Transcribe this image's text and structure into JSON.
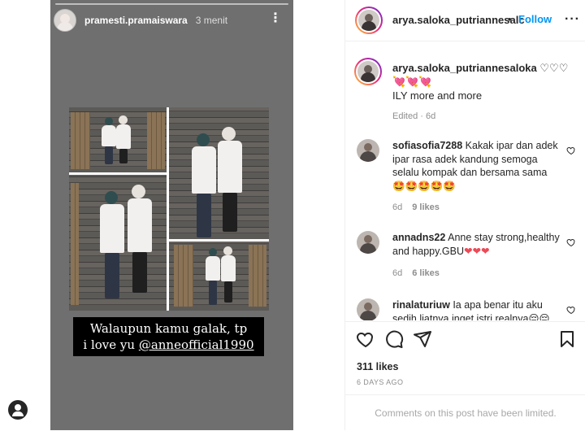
{
  "story": {
    "username": "pramesti.pramaiswara",
    "time": "3 menit",
    "more_icon": "⋮",
    "caption_line1": "Walaupun kamu galak, tp",
    "caption_line2_prefix": "i love yu ",
    "caption_mention": "@anneofficial1990"
  },
  "post": {
    "header": {
      "username": "arya.saloka_putriannesalc",
      "separator": "•",
      "follow_label": "Follow",
      "more_icon": "···"
    },
    "caption": {
      "username": "arya.saloka_putriannesaloka",
      "text_line1": "♡♡♡",
      "text_line2": "💘💘💘",
      "text_line3": "ILY more and more",
      "meta": "Edited · 6d"
    },
    "comments": [
      {
        "username": "sofiasofia7288",
        "text": "Kakak ipar dan adek ipar rasa adek kandung semoga selalu kompak dan bersama sama",
        "emoji": "🤩🤩🤩🤩🤩",
        "age": "6d",
        "likes": "9 likes"
      },
      {
        "username": "annadns22",
        "text": "Anne stay strong,healthy and happy.GBU",
        "emoji": "❤❤❤",
        "age": "6d",
        "likes": "6 likes"
      },
      {
        "username": "rinalaturiuw",
        "text": "Ia apa benar itu aku sedih liatnya inget istri realnya",
        "emoji": "😔😔",
        "age": "",
        "likes": ""
      }
    ],
    "likes_count": "311 likes",
    "date": "6 DAYS AGO",
    "limited_notice": "Comments on this post have been limited."
  },
  "colors": {
    "story_bg": "#6f6f6f",
    "follow_blue": "#0095f6",
    "meta_gray": "#8e8e8e",
    "heart_red": "#ed4956"
  }
}
